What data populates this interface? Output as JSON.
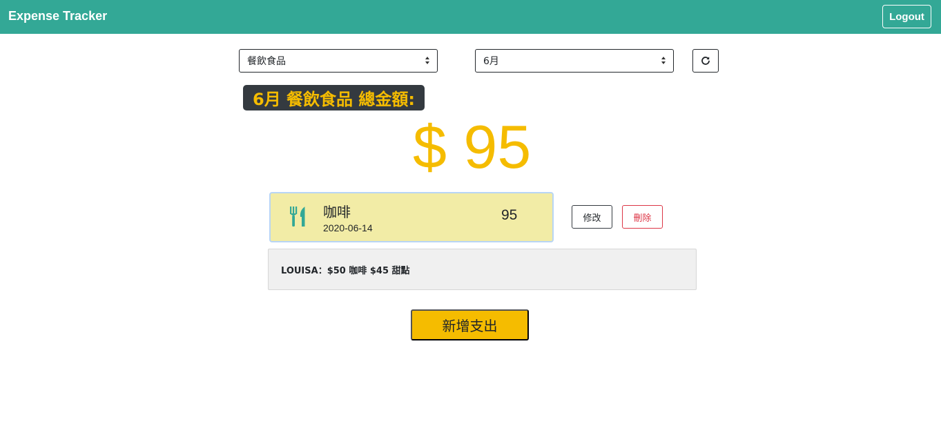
{
  "navbar": {
    "brand": "Expense Tracker",
    "logout_label": "Logout",
    "color": "#33a896"
  },
  "filters": {
    "category_selected": "餐飲食品",
    "month_selected": "6月",
    "refresh_icon": "refresh-icon"
  },
  "summary": {
    "label": "6月 餐飲食品 總金額:",
    "amount": "$ 95",
    "accent_color": "#f5bc00"
  },
  "records": [
    {
      "icon": "utensils-icon",
      "name": "咖啡",
      "date": "2020-06-14",
      "amount": "95",
      "edit_label": "修改",
      "delete_label": "刪除",
      "memo": "LOUISA：$50 咖啡 $45 甜點"
    }
  ],
  "actions": {
    "add_label": "新增支出"
  }
}
